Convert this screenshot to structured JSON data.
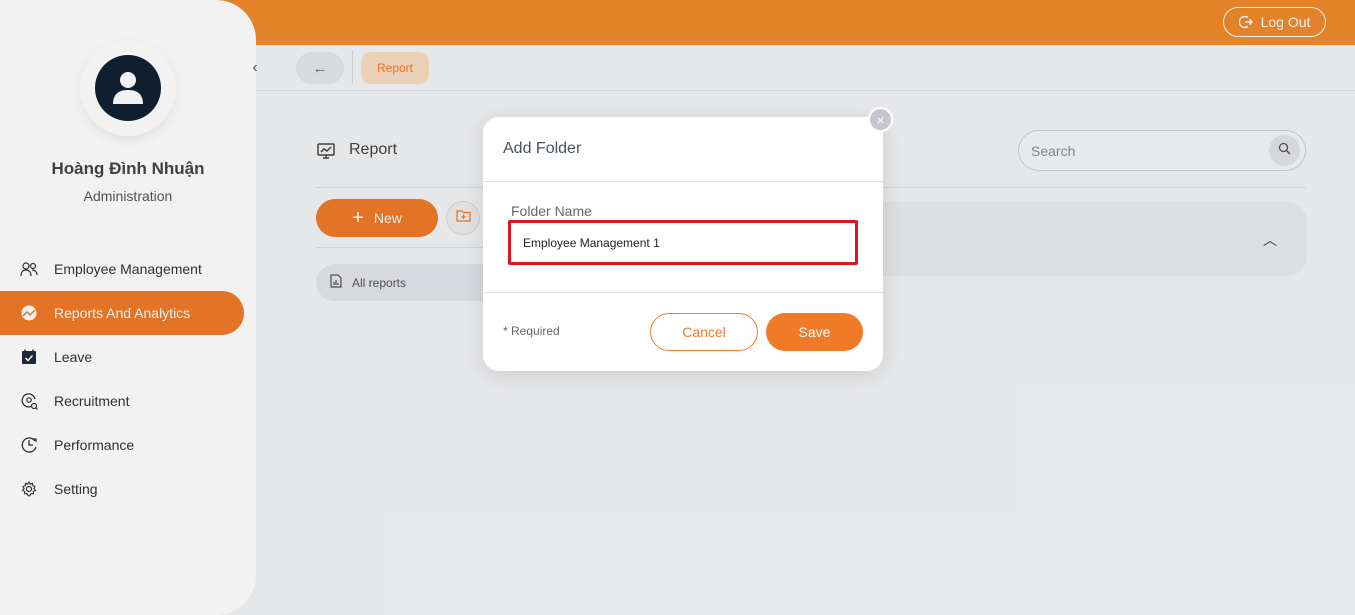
{
  "header": {
    "logout_label": "Log Out"
  },
  "sidebar": {
    "user_name": "Hoàng Đình Nhuận",
    "user_role": "Administration",
    "items": [
      {
        "label": "Employee Management",
        "icon": "users-icon"
      },
      {
        "label": "Reports And Analytics",
        "icon": "chart-icon",
        "active": true
      },
      {
        "label": "Leave",
        "icon": "calendar-check-icon"
      },
      {
        "label": "Recruitment",
        "icon": "recruitment-icon"
      },
      {
        "label": "Performance",
        "icon": "performance-icon"
      },
      {
        "label": "Setting",
        "icon": "gear-icon"
      }
    ]
  },
  "breadcrumb": {
    "current": "Report"
  },
  "page": {
    "title": "Report",
    "search_placeholder": "Search",
    "new_button": "New",
    "all_reports": "All reports"
  },
  "modal": {
    "title": "Add Folder",
    "field_label": "Folder Name",
    "field_value": "Employee Management 1",
    "required_note": "* Required",
    "cancel_label": "Cancel",
    "save_label": "Save"
  },
  "colors": {
    "accent": "#f07a28",
    "topbar": "#f08a2c",
    "highlight_border": "#e0141c",
    "avatar_bg": "#0f2233"
  }
}
